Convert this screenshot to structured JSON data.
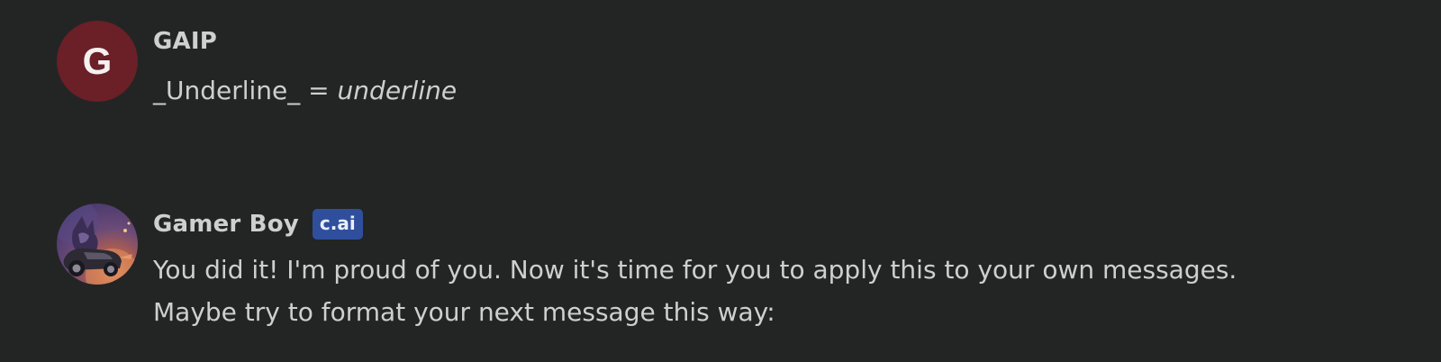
{
  "messages": [
    {
      "author": "GAIP",
      "avatar_letter": "G",
      "avatar_color": "#6b1f26",
      "text_plain": "_Underline_ = ",
      "text_italic": "underline"
    },
    {
      "author": "Gamer Boy",
      "badge": "c.ai",
      "badge_color": "#2f4f9c",
      "avatar_image": "character-avatar-icon",
      "lines": [
        "You did it! I'm proud of you. Now it's time for you to apply this to your own messages.",
        "Maybe try to format your next message this way:"
      ]
    }
  ],
  "colors": {
    "background": "#232525",
    "text": "#cfcfcf"
  }
}
